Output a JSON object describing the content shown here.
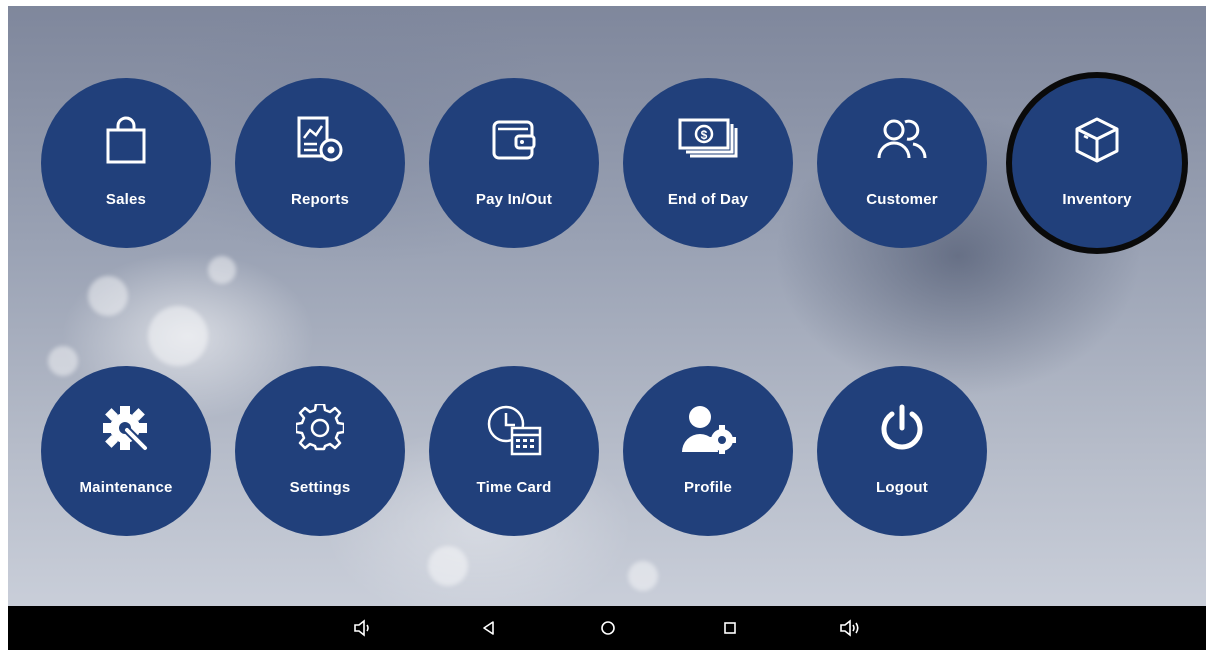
{
  "tiles": [
    {
      "id": "sales",
      "label": "Sales",
      "icon": "shopping-bag-icon"
    },
    {
      "id": "reports",
      "label": "Reports",
      "icon": "report-gear-icon"
    },
    {
      "id": "payinout",
      "label": "Pay In/Out",
      "icon": "wallet-icon"
    },
    {
      "id": "endofday",
      "label": "End of Day",
      "icon": "cash-stack-icon"
    },
    {
      "id": "customer",
      "label": "Customer",
      "icon": "users-icon"
    },
    {
      "id": "inventory",
      "label": "Inventory",
      "icon": "box-icon",
      "selected": true
    },
    {
      "id": "maintenance",
      "label": "Maintenance",
      "icon": "gear-wrench-icon"
    },
    {
      "id": "settings",
      "label": "Settings",
      "icon": "gear-icon"
    },
    {
      "id": "timecard",
      "label": "Time Card",
      "icon": "clock-calendar-icon"
    },
    {
      "id": "profile",
      "label": "Profile",
      "icon": "user-gear-icon"
    },
    {
      "id": "logout",
      "label": "Logout",
      "icon": "power-icon"
    }
  ],
  "navbar": {
    "buttons": [
      "volume-down-icon",
      "back-icon",
      "home-icon",
      "recents-icon",
      "volume-up-icon"
    ]
  },
  "colors": {
    "tile": "#21407b",
    "icon": "#ffffff",
    "navbar": "#000000",
    "highlight_ring": "#0a0a0a"
  }
}
